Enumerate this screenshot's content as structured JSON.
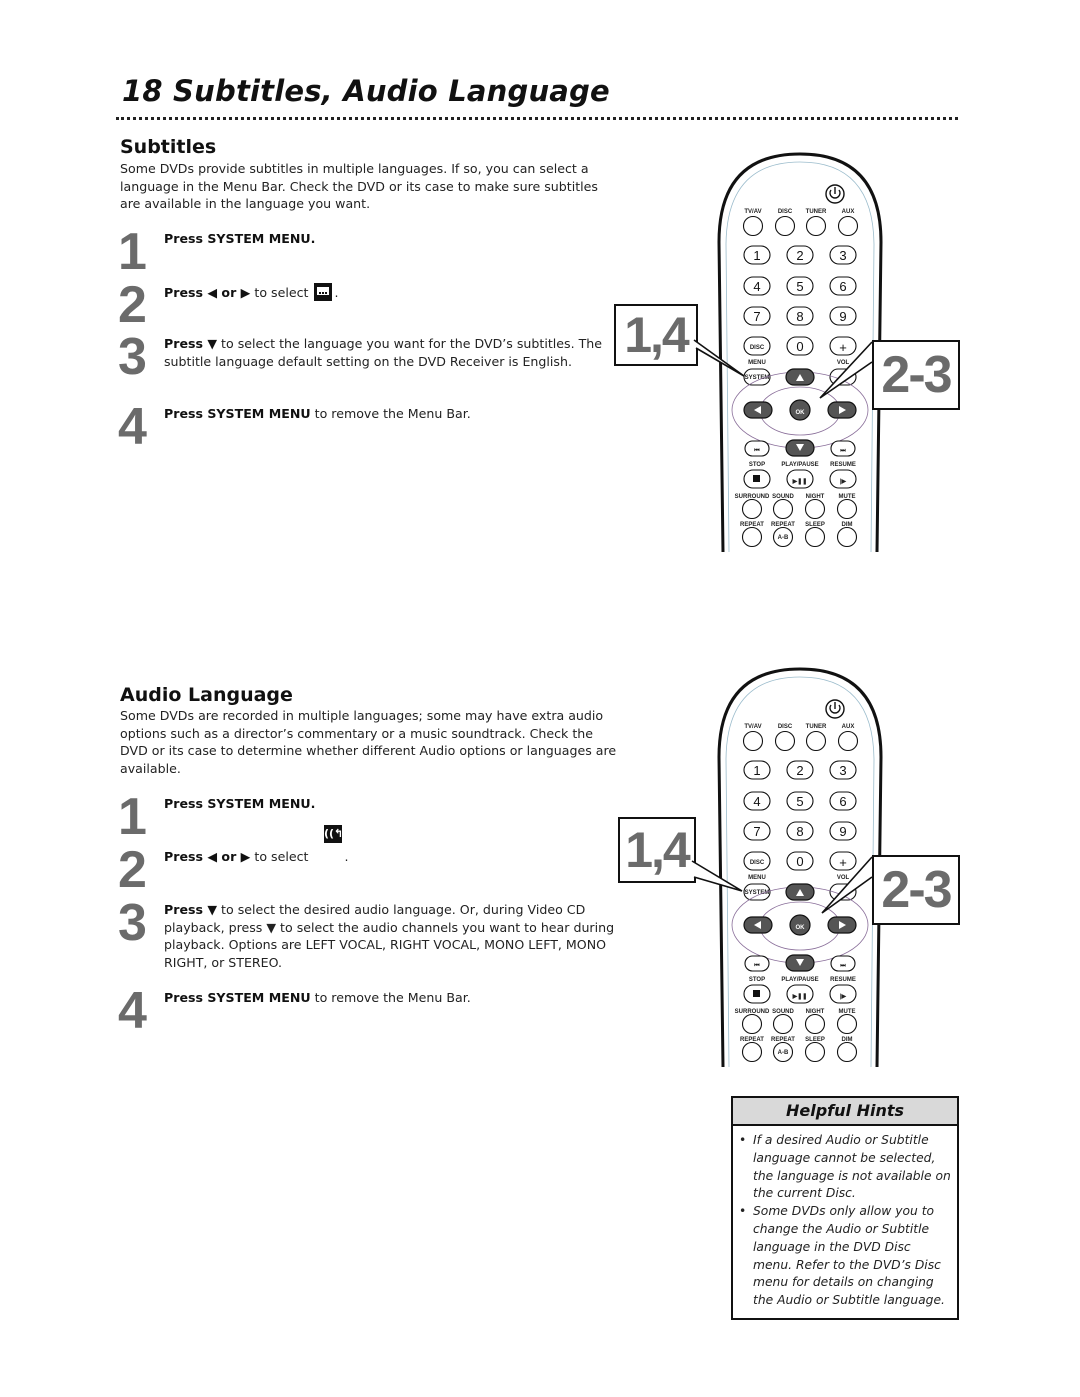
{
  "page": {
    "title": "18  Subtitles, Audio Language"
  },
  "subtitles": {
    "heading": "Subtitles",
    "intro": "Some DVDs provide subtitles in multiple languages. If so, you can select a language in the Menu Bar. Check the DVD or its case to make sure subtitles are available in the language you want.",
    "steps": [
      {
        "number": "1",
        "bold": "Press SYSTEM MENU.",
        "rest": ""
      },
      {
        "number": "2",
        "bold": "Press ◀ or ▶",
        "rest": " to select",
        "icon": "subtitle-icon"
      },
      {
        "number": "3",
        "bold": "Press ▼",
        "rest": " to select the language you want for the DVD’s subtitles. The subtitle language default setting on the DVD Receiver is English."
      },
      {
        "number": "4",
        "bold": "Press SYSTEM MENU",
        "rest": " to remove the Menu Bar."
      }
    ]
  },
  "audio": {
    "heading": "Audio Language",
    "intro": "Some DVDs are recorded in multiple languages; some may have extra audio options such as a director’s commentary or a music soundtrack. Check the DVD or its case to determine whether different Audio options or languages are available.",
    "steps": [
      {
        "number": "1",
        "bold": "Press SYSTEM MENU.",
        "rest": ""
      },
      {
        "number": "2",
        "bold": "Press ◀ or ▶",
        "rest": " to select",
        "icon": "audio-language-icon"
      },
      {
        "number": "3",
        "bold": "Press ▼",
        "rest": " to select the desired audio language. Or, during Video CD playback, press ▼ to select the audio channels you want to hear during playback. Options are LEFT VOCAL, RIGHT VOCAL, MONO LEFT, MONO RIGHT, or STEREO."
      },
      {
        "number": "4",
        "bold": "Press SYSTEM MENU",
        "rest": " to remove the Menu Bar."
      }
    ]
  },
  "callouts": {
    "left": "1,4",
    "right": "2-3"
  },
  "remote": {
    "source_labels": [
      "TV/AV",
      "DISC",
      "TUNER",
      "AUX"
    ],
    "digits": [
      "1",
      "2",
      "3",
      "4",
      "5",
      "6",
      "7",
      "8",
      "9"
    ],
    "zero": "0",
    "disc_label": "DISC",
    "menu_label": "MENU",
    "system_label": "SYSTEM",
    "vol_label": "VOL",
    "plus": "+",
    "ok": "OK",
    "transport_labels": [
      "STOP",
      "PLAY/PAUSE",
      "RESUME"
    ],
    "row_labels_1": [
      "SURROUND",
      "SOUND",
      "NIGHT",
      "MUTE"
    ],
    "row_labels_2": [
      "REPEAT",
      "REPEAT",
      "SLEEP",
      "DIM"
    ],
    "ab_label": "A-B"
  },
  "hints": {
    "title": "Helpful Hints",
    "items": [
      "If a desired Audio or Subtitle language cannot be selected, the language is not available on the current Disc.",
      "Some DVDs only allow you to change the Audio or Subtitle language in the DVD Disc menu. Refer to the DVD’s Disc menu for details on changing the Audio or Subtitle language."
    ]
  }
}
